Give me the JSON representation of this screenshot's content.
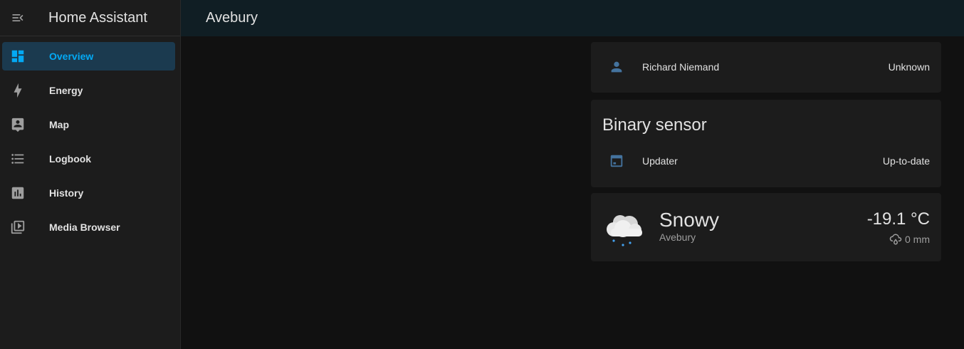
{
  "sidebar": {
    "title": "Home Assistant",
    "items": [
      {
        "label": "Overview",
        "icon": "view-dashboard-icon",
        "active": true
      },
      {
        "label": "Energy",
        "icon": "lightning-bolt-icon"
      },
      {
        "label": "Map",
        "icon": "map-account-icon"
      },
      {
        "label": "Logbook",
        "icon": "format-list-bulleted-icon"
      },
      {
        "label": "History",
        "icon": "chart-box-icon"
      },
      {
        "label": "Media Browser",
        "icon": "play-box-multiple-icon"
      }
    ]
  },
  "topbar": {
    "title": "Avebury"
  },
  "person_card": {
    "name": "Richard Niemand",
    "state": "Unknown",
    "icon": "account-icon"
  },
  "binary_sensor_card": {
    "title": "Binary sensor",
    "entity": {
      "name": "Updater",
      "state": "Up-to-date",
      "icon": "package-icon"
    }
  },
  "weather_card": {
    "condition": "Snowy",
    "location": "Avebury",
    "temperature": "-19.1 °C",
    "precipitation": "0 mm",
    "icon": "weather-snowy-icon"
  },
  "colors": {
    "accent": "#03a9f4",
    "background": "#111111",
    "card": "#1c1c1c",
    "topbar": "#101e24",
    "active_nav": "#1b3a4f",
    "icon_blue": "#44739e"
  }
}
